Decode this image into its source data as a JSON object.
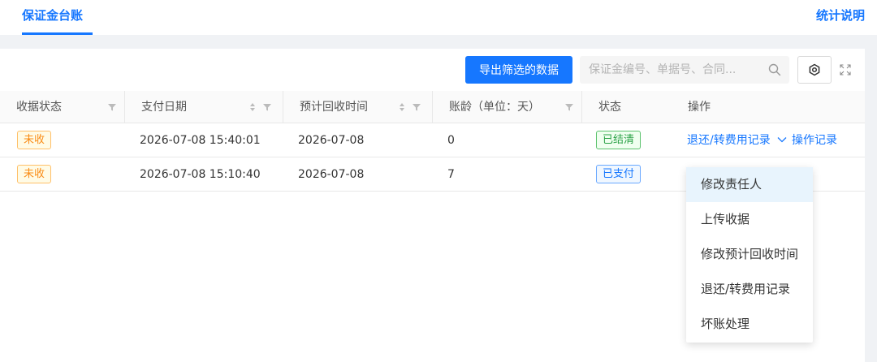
{
  "header": {
    "tab_label": "保证金台账",
    "help_link": "统计说明"
  },
  "toolbar": {
    "export_label": "导出筛选的数据",
    "search_placeholder": "保证金编号、单据号、合同..."
  },
  "table": {
    "columns": [
      "收据状态",
      "支付日期",
      "预计回收时间",
      "账龄（单位：天）",
      "状态",
      "操作"
    ],
    "rows": [
      {
        "receipt_status": "未收",
        "pay_date": "2026-07-08 15:40:01",
        "expected_return": "2026-07-08",
        "age_days": "0",
        "status": "已结清",
        "op_more": "退还/转费用记录",
        "op_log": "操作记录"
      },
      {
        "receipt_status": "未收",
        "pay_date": "2026-07-08 15:10:40",
        "expected_return": "2026-07-08",
        "age_days": "7",
        "status": "已支付"
      }
    ]
  },
  "dropdown": {
    "items": [
      "修改责任人",
      "上传收据",
      "修改预计回收时间",
      "退还/转费用记录",
      "坏账处理"
    ],
    "active_index": 0
  },
  "colors": {
    "primary": "#1677ff",
    "tag_orange": "#fa8c16",
    "tag_green": "#2aa146",
    "tag_blue": "#1677ff"
  }
}
